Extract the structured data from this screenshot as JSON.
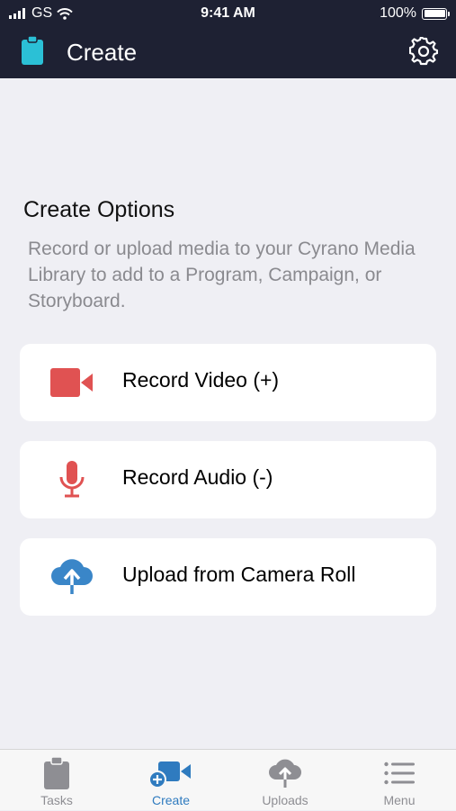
{
  "status_bar": {
    "carrier": "GS",
    "time": "9:41 AM",
    "battery": "100%"
  },
  "header": {
    "title": "Create",
    "app_icon": "clipboard-icon",
    "settings_icon": "gear-icon"
  },
  "create_options": {
    "title": "Create Options",
    "description": "Record or upload media to your Cyrano Media Library to add to a Program, Campaign, or Storyboard.",
    "items": [
      {
        "label": "Record Video (+)",
        "icon": "video-camera-icon",
        "color": "#e05252"
      },
      {
        "label": "Record Audio (-)",
        "icon": "microphone-icon",
        "color": "#e05252"
      },
      {
        "label": "Upload from Camera Roll",
        "icon": "cloud-upload-icon",
        "color": "#3a86c8"
      }
    ]
  },
  "tab_bar": {
    "active": "Create",
    "tabs": [
      {
        "label": "Tasks",
        "icon": "clipboard-icon"
      },
      {
        "label": "Create",
        "icon": "video-camera-add-icon"
      },
      {
        "label": "Uploads",
        "icon": "cloud-upload-icon"
      },
      {
        "label": "Menu",
        "icon": "list-icon"
      }
    ]
  },
  "colors": {
    "header_bg": "#1e2133",
    "accent": "#2f7bbf",
    "app_icon": "#2bc0d6",
    "record": "#e05252",
    "upload": "#3a86c8",
    "inactive_tab": "#8e8e93",
    "background": "#efeff4"
  }
}
